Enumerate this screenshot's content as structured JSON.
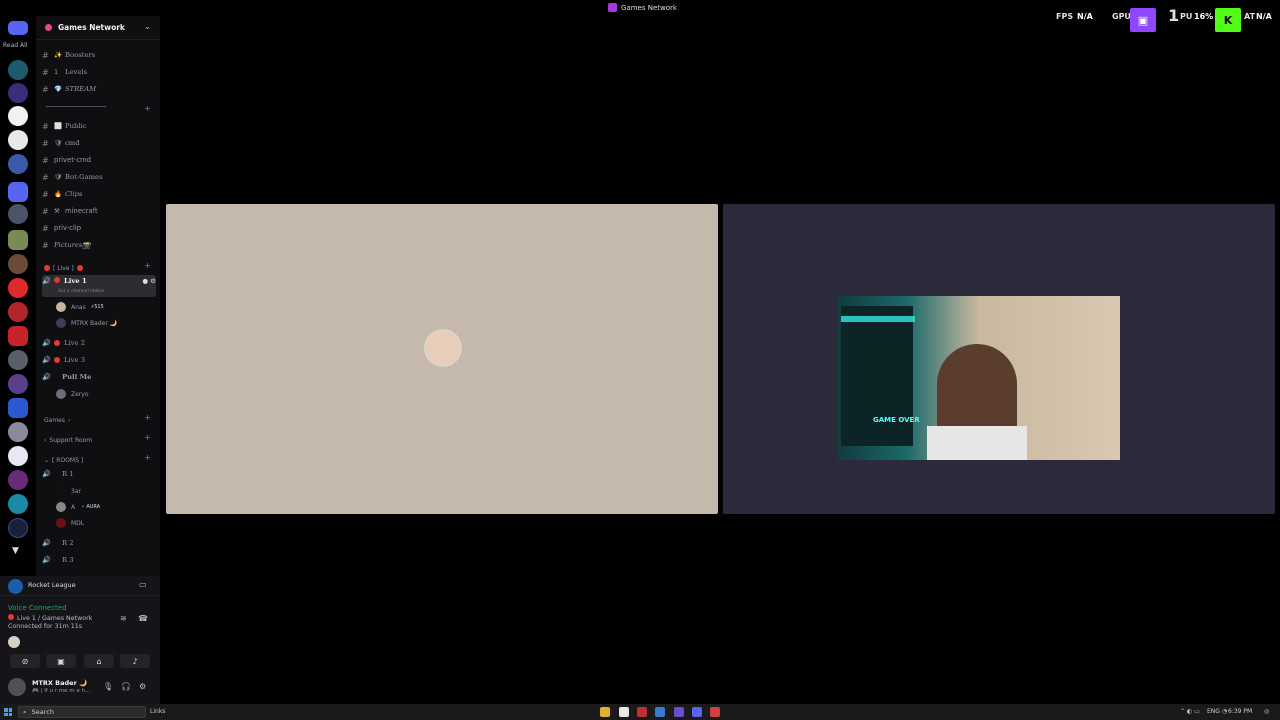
{
  "window": {
    "title": "Games Network"
  },
  "rail": {
    "read_all": "Read All"
  },
  "server": {
    "name": "Games Network"
  },
  "channels": [
    {
      "emoji": "✨",
      "label": "Boosters",
      "style": "serif"
    },
    {
      "emoji": "1",
      "label": "Levels",
      "style": "serif"
    },
    {
      "emoji": "💎",
      "label": "STREAM",
      "style": "serif-ital"
    },
    {
      "emoji": "⬜",
      "label": "Public",
      "style": "serif"
    },
    {
      "emoji": "🛡",
      "label": "cmd",
      "style": "serif"
    },
    {
      "emoji": "",
      "label": "privet-cmd",
      "style": "plain"
    },
    {
      "emoji": "🛡",
      "label": "Bot-Games",
      "style": "serif"
    },
    {
      "emoji": "🔥",
      "label": "Clips",
      "style": "serif-ital"
    },
    {
      "emoji": "⚒",
      "label": "minecraft",
      "style": "plain"
    },
    {
      "emoji": "",
      "label": "priv-clip",
      "style": "plain"
    },
    {
      "emoji": "",
      "label": "Pictures📸",
      "style": "serif-ital"
    }
  ],
  "live_category": "[ Live ]",
  "voice_channels": {
    "live1": "Live 1",
    "live1_status": "Set a channel status",
    "live1_users": [
      {
        "name": "Anas",
        "tag": "⚡515"
      },
      {
        "name": "MTRX Bader 🌙",
        "tag": ""
      }
    ],
    "live2": "Live 2",
    "live3": "Live 3",
    "pull_me": "Pull Me",
    "pull_me_users": [
      {
        "name": "Zeryo"
      }
    ]
  },
  "categories": {
    "games": "Games",
    "support_room": "Support Room",
    "rooms": "[ ROOMS ]"
  },
  "rooms": {
    "r1": "R 1",
    "r1_users": [
      {
        "name": "3ar"
      },
      {
        "name": "A",
        "tag": "🔹AURA"
      },
      {
        "name": "MDL"
      }
    ],
    "r2": "R 2",
    "r3": "R 3"
  },
  "panel": {
    "activity": "Rocket League",
    "vc_status": "Voice Connected",
    "vc_channel": "Live 1 / Games Network",
    "vc_time": "Connected for 31m 11s",
    "user_name": "MTRX Bader 🌙",
    "user_status": "🎮 | If u r me m e h..."
  },
  "hud": {
    "fps_label": "FPS",
    "fps_value": "N/A",
    "gpu_label": "GPU",
    "num": "1",
    "cpu_label": "PU",
    "cpu_value": "16%",
    "lat_label": "AT",
    "lat_value": "N/A"
  },
  "webcam": {
    "sign": "GAME OVER"
  },
  "taskbar": {
    "search": "Search",
    "links": "Links",
    "lang": "ENG",
    "time": "6:39 PM"
  },
  "colors": {
    "accent": "#5865f2",
    "voice_connected": "#23a55a",
    "live_dot": "#e53935",
    "twitch": "#9146ff",
    "kick": "#53fc18"
  }
}
